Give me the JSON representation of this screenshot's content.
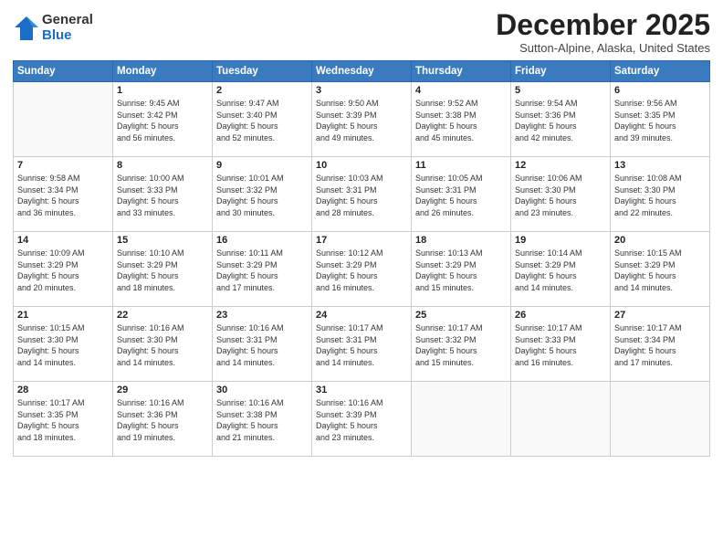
{
  "logo": {
    "general": "General",
    "blue": "Blue"
  },
  "title": "December 2025",
  "location": "Sutton-Alpine, Alaska, United States",
  "days_of_week": [
    "Sunday",
    "Monday",
    "Tuesday",
    "Wednesday",
    "Thursday",
    "Friday",
    "Saturday"
  ],
  "weeks": [
    [
      {
        "day": "",
        "info": ""
      },
      {
        "day": "1",
        "info": "Sunrise: 9:45 AM\nSunset: 3:42 PM\nDaylight: 5 hours\nand 56 minutes."
      },
      {
        "day": "2",
        "info": "Sunrise: 9:47 AM\nSunset: 3:40 PM\nDaylight: 5 hours\nand 52 minutes."
      },
      {
        "day": "3",
        "info": "Sunrise: 9:50 AM\nSunset: 3:39 PM\nDaylight: 5 hours\nand 49 minutes."
      },
      {
        "day": "4",
        "info": "Sunrise: 9:52 AM\nSunset: 3:38 PM\nDaylight: 5 hours\nand 45 minutes."
      },
      {
        "day": "5",
        "info": "Sunrise: 9:54 AM\nSunset: 3:36 PM\nDaylight: 5 hours\nand 42 minutes."
      },
      {
        "day": "6",
        "info": "Sunrise: 9:56 AM\nSunset: 3:35 PM\nDaylight: 5 hours\nand 39 minutes."
      }
    ],
    [
      {
        "day": "7",
        "info": "Sunrise: 9:58 AM\nSunset: 3:34 PM\nDaylight: 5 hours\nand 36 minutes."
      },
      {
        "day": "8",
        "info": "Sunrise: 10:00 AM\nSunset: 3:33 PM\nDaylight: 5 hours\nand 33 minutes."
      },
      {
        "day": "9",
        "info": "Sunrise: 10:01 AM\nSunset: 3:32 PM\nDaylight: 5 hours\nand 30 minutes."
      },
      {
        "day": "10",
        "info": "Sunrise: 10:03 AM\nSunset: 3:31 PM\nDaylight: 5 hours\nand 28 minutes."
      },
      {
        "day": "11",
        "info": "Sunrise: 10:05 AM\nSunset: 3:31 PM\nDaylight: 5 hours\nand 26 minutes."
      },
      {
        "day": "12",
        "info": "Sunrise: 10:06 AM\nSunset: 3:30 PM\nDaylight: 5 hours\nand 23 minutes."
      },
      {
        "day": "13",
        "info": "Sunrise: 10:08 AM\nSunset: 3:30 PM\nDaylight: 5 hours\nand 22 minutes."
      }
    ],
    [
      {
        "day": "14",
        "info": "Sunrise: 10:09 AM\nSunset: 3:29 PM\nDaylight: 5 hours\nand 20 minutes."
      },
      {
        "day": "15",
        "info": "Sunrise: 10:10 AM\nSunset: 3:29 PM\nDaylight: 5 hours\nand 18 minutes."
      },
      {
        "day": "16",
        "info": "Sunrise: 10:11 AM\nSunset: 3:29 PM\nDaylight: 5 hours\nand 17 minutes."
      },
      {
        "day": "17",
        "info": "Sunrise: 10:12 AM\nSunset: 3:29 PM\nDaylight: 5 hours\nand 16 minutes."
      },
      {
        "day": "18",
        "info": "Sunrise: 10:13 AM\nSunset: 3:29 PM\nDaylight: 5 hours\nand 15 minutes."
      },
      {
        "day": "19",
        "info": "Sunrise: 10:14 AM\nSunset: 3:29 PM\nDaylight: 5 hours\nand 14 minutes."
      },
      {
        "day": "20",
        "info": "Sunrise: 10:15 AM\nSunset: 3:29 PM\nDaylight: 5 hours\nand 14 minutes."
      }
    ],
    [
      {
        "day": "21",
        "info": "Sunrise: 10:15 AM\nSunset: 3:30 PM\nDaylight: 5 hours\nand 14 minutes."
      },
      {
        "day": "22",
        "info": "Sunrise: 10:16 AM\nSunset: 3:30 PM\nDaylight: 5 hours\nand 14 minutes."
      },
      {
        "day": "23",
        "info": "Sunrise: 10:16 AM\nSunset: 3:31 PM\nDaylight: 5 hours\nand 14 minutes."
      },
      {
        "day": "24",
        "info": "Sunrise: 10:17 AM\nSunset: 3:31 PM\nDaylight: 5 hours\nand 14 minutes."
      },
      {
        "day": "25",
        "info": "Sunrise: 10:17 AM\nSunset: 3:32 PM\nDaylight: 5 hours\nand 15 minutes."
      },
      {
        "day": "26",
        "info": "Sunrise: 10:17 AM\nSunset: 3:33 PM\nDaylight: 5 hours\nand 16 minutes."
      },
      {
        "day": "27",
        "info": "Sunrise: 10:17 AM\nSunset: 3:34 PM\nDaylight: 5 hours\nand 17 minutes."
      }
    ],
    [
      {
        "day": "28",
        "info": "Sunrise: 10:17 AM\nSunset: 3:35 PM\nDaylight: 5 hours\nand 18 minutes."
      },
      {
        "day": "29",
        "info": "Sunrise: 10:16 AM\nSunset: 3:36 PM\nDaylight: 5 hours\nand 19 minutes."
      },
      {
        "day": "30",
        "info": "Sunrise: 10:16 AM\nSunset: 3:38 PM\nDaylight: 5 hours\nand 21 minutes."
      },
      {
        "day": "31",
        "info": "Sunrise: 10:16 AM\nSunset: 3:39 PM\nDaylight: 5 hours\nand 23 minutes."
      },
      {
        "day": "",
        "info": ""
      },
      {
        "day": "",
        "info": ""
      },
      {
        "day": "",
        "info": ""
      }
    ]
  ]
}
